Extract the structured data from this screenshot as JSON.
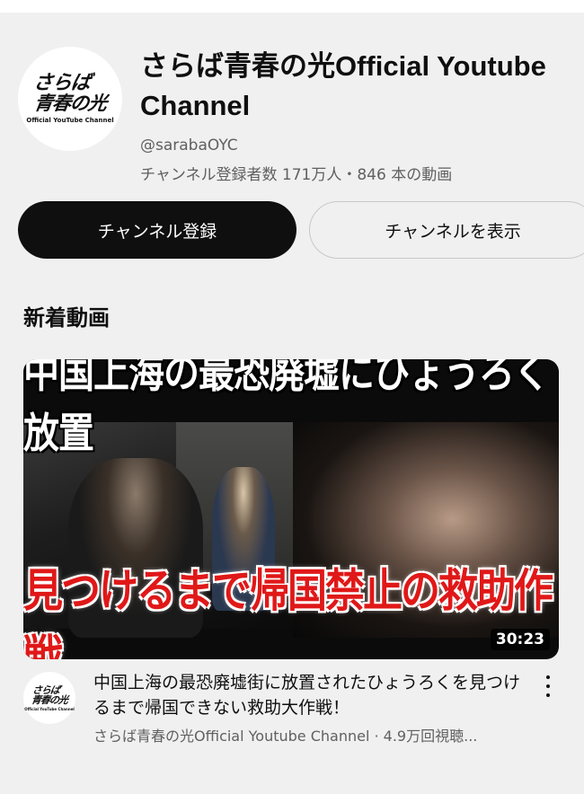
{
  "channel": {
    "name": "さらば青春の光Official Youtube Channel",
    "handle": "@sarabaOYC",
    "meta": "チャンネル登録者数 171万人・846 本の動画",
    "logo_line1": "さらば",
    "logo_line2": "青春の光",
    "logo_sub": "Official YouTube Channel"
  },
  "buttons": {
    "subscribe": "チャンネル登録",
    "view_channel": "チャンネルを表示"
  },
  "section": {
    "title": "新着動画"
  },
  "video": {
    "thumbnail_text_top": "中国上海の最恐廃墟にひょうろく放置",
    "thumbnail_text_bottom": "見つけるまで帰国禁止の救助作戦",
    "duration": "30:23",
    "title": "中国上海の最恐廃墟街に放置されたひょうろくを見つけるまで帰国できない救助大作戦！",
    "meta": "さらば青春の光Official Youtube Channel · 4.9万回視聴..."
  },
  "colors": {
    "background": "#f0f0f0",
    "subscribe_button": "#0f0f0f",
    "secondary_text": "#606060",
    "thumbnail_red_text": "#e01818"
  }
}
